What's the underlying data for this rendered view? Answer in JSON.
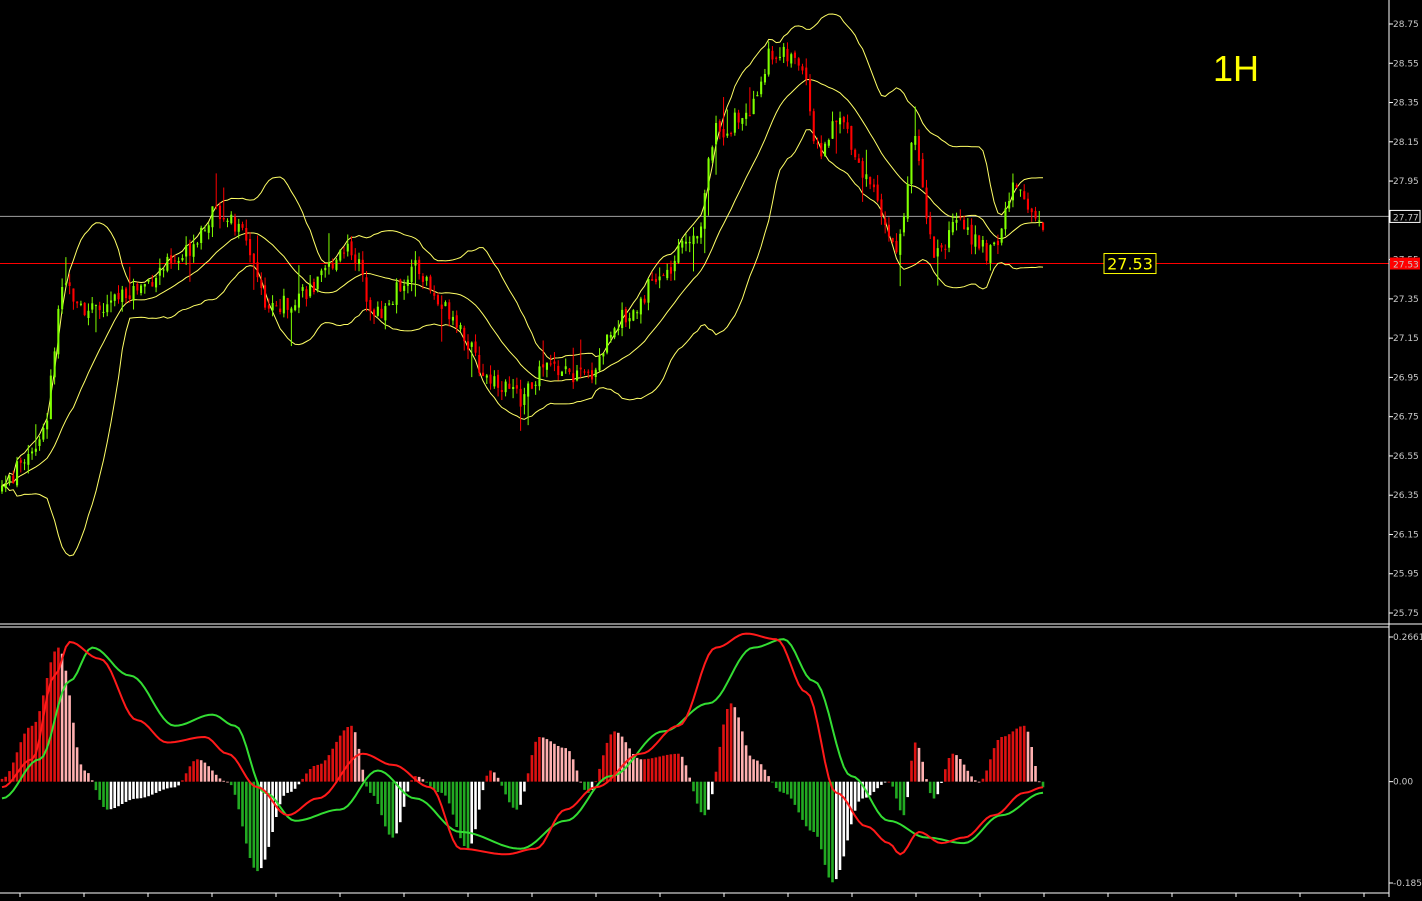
{
  "timeframe_label": "1H",
  "colors": {
    "background": "#000000",
    "bullish_candle": "#7fff00",
    "bearish_candle": "#ff0000",
    "bollinger": "#ffff66",
    "price_line": "#a0a0a0",
    "level_line": "#ff0000",
    "macd_line": "#ff1a1a",
    "signal_line": "#33dd33",
    "hist_pos_strong": "#dd1111",
    "hist_pos_weak": "#ffb0b0",
    "hist_neg_strong": "#22aa22",
    "hist_neg_weak": "#ffffff"
  },
  "chart_data": [
    {
      "type": "candlestick",
      "title": "",
      "indicators": [
        "Bollinger Bands"
      ],
      "y_ticks": [
        "28.75",
        "28.55",
        "28.35",
        "28.15",
        "27.95",
        "27.55",
        "27.35",
        "27.15",
        "26.95",
        "26.75",
        "26.55",
        "26.35",
        "26.15",
        "25.95",
        "25.75"
      ],
      "ylim": [
        25.7,
        28.85
      ],
      "current_price": 27.77,
      "current_price_label": "27.77",
      "level": 27.53,
      "level_label": "27.53",
      "level_axis_label": "27.53",
      "key_points": [
        {
          "i": 0,
          "v": 26.4
        },
        {
          "i": 10,
          "v": 26.62
        },
        {
          "i": 17,
          "v": 27.4
        },
        {
          "i": 25,
          "v": 27.28
        },
        {
          "i": 35,
          "v": 27.4
        },
        {
          "i": 45,
          "v": 27.52
        },
        {
          "i": 58,
          "v": 27.8
        },
        {
          "i": 63,
          "v": 27.7
        },
        {
          "i": 72,
          "v": 27.3
        },
        {
          "i": 82,
          "v": 27.4
        },
        {
          "i": 92,
          "v": 27.62
        },
        {
          "i": 100,
          "v": 27.28
        },
        {
          "i": 110,
          "v": 27.5
        },
        {
          "i": 118,
          "v": 27.3
        },
        {
          "i": 130,
          "v": 26.95
        },
        {
          "i": 138,
          "v": 26.85
        },
        {
          "i": 145,
          "v": 27.0
        },
        {
          "i": 155,
          "v": 26.95
        },
        {
          "i": 165,
          "v": 27.25
        },
        {
          "i": 175,
          "v": 27.45
        },
        {
          "i": 185,
          "v": 27.7
        },
        {
          "i": 190,
          "v": 28.2
        },
        {
          "i": 198,
          "v": 28.28
        },
        {
          "i": 205,
          "v": 28.6
        },
        {
          "i": 213,
          "v": 28.55
        },
        {
          "i": 217,
          "v": 28.1
        },
        {
          "i": 223,
          "v": 28.25
        },
        {
          "i": 231,
          "v": 27.95
        },
        {
          "i": 238,
          "v": 27.6
        },
        {
          "i": 243,
          "v": 28.15
        },
        {
          "i": 248,
          "v": 27.6
        },
        {
          "i": 255,
          "v": 27.72
        },
        {
          "i": 263,
          "v": 27.58
        },
        {
          "i": 270,
          "v": 27.92
        },
        {
          "i": 277,
          "v": 27.72
        }
      ],
      "bollinger": {
        "period": 20,
        "deviation": 2
      }
    },
    {
      "type": "bar",
      "title": "",
      "indicator": "MACD",
      "y_ticks": [
        "0.2661",
        "0.00",
        "-0.185"
      ],
      "ylim": [
        -0.185,
        0.2661
      ],
      "histogram_key_points": [
        {
          "i": 0,
          "v": 0.005
        },
        {
          "i": 8,
          "v": 0.1
        },
        {
          "i": 15,
          "v": 0.24
        },
        {
          "i": 22,
          "v": 0.02
        },
        {
          "i": 28,
          "v": -0.05
        },
        {
          "i": 36,
          "v": -0.03
        },
        {
          "i": 46,
          "v": -0.01
        },
        {
          "i": 52,
          "v": 0.04
        },
        {
          "i": 60,
          "v": 0.0
        },
        {
          "i": 68,
          "v": -0.16
        },
        {
          "i": 76,
          "v": -0.02
        },
        {
          "i": 84,
          "v": 0.03
        },
        {
          "i": 93,
          "v": 0.1
        },
        {
          "i": 98,
          "v": -0.02
        },
        {
          "i": 104,
          "v": -0.1
        },
        {
          "i": 110,
          "v": 0.01
        },
        {
          "i": 117,
          "v": -0.02
        },
        {
          "i": 124,
          "v": -0.12
        },
        {
          "i": 130,
          "v": 0.02
        },
        {
          "i": 137,
          "v": -0.05
        },
        {
          "i": 143,
          "v": 0.08
        },
        {
          "i": 150,
          "v": 0.06
        },
        {
          "i": 156,
          "v": -0.02
        },
        {
          "i": 163,
          "v": 0.09
        },
        {
          "i": 170,
          "v": 0.04
        },
        {
          "i": 180,
          "v": 0.05
        },
        {
          "i": 187,
          "v": -0.06
        },
        {
          "i": 194,
          "v": 0.14
        },
        {
          "i": 200,
          "v": 0.04
        },
        {
          "i": 208,
          "v": -0.02
        },
        {
          "i": 216,
          "v": -0.09
        },
        {
          "i": 221,
          "v": -0.18
        },
        {
          "i": 229,
          "v": -0.03
        },
        {
          "i": 236,
          "v": 0.0
        },
        {
          "i": 240,
          "v": -0.06
        },
        {
          "i": 243,
          "v": 0.07
        },
        {
          "i": 248,
          "v": -0.03
        },
        {
          "i": 253,
          "v": 0.05
        },
        {
          "i": 260,
          "v": 0.0
        },
        {
          "i": 266,
          "v": 0.08
        },
        {
          "i": 272,
          "v": 0.1
        },
        {
          "i": 277,
          "v": -0.01
        }
      ],
      "macd_key_points": [
        {
          "i": 0,
          "v": -0.01
        },
        {
          "i": 8,
          "v": 0.04
        },
        {
          "i": 14,
          "v": 0.19
        },
        {
          "i": 18,
          "v": 0.25
        },
        {
          "i": 26,
          "v": 0.22
        },
        {
          "i": 36,
          "v": 0.11
        },
        {
          "i": 44,
          "v": 0.07
        },
        {
          "i": 54,
          "v": 0.08
        },
        {
          "i": 60,
          "v": 0.05
        },
        {
          "i": 68,
          "v": -0.01
        },
        {
          "i": 76,
          "v": -0.06
        },
        {
          "i": 84,
          "v": -0.03
        },
        {
          "i": 96,
          "v": 0.05
        },
        {
          "i": 104,
          "v": 0.03
        },
        {
          "i": 114,
          "v": -0.01
        },
        {
          "i": 122,
          "v": -0.12
        },
        {
          "i": 134,
          "v": -0.13
        },
        {
          "i": 142,
          "v": -0.12
        },
        {
          "i": 150,
          "v": -0.05
        },
        {
          "i": 158,
          "v": -0.01
        },
        {
          "i": 170,
          "v": 0.05
        },
        {
          "i": 180,
          "v": 0.1
        },
        {
          "i": 190,
          "v": 0.24
        },
        {
          "i": 198,
          "v": 0.265
        },
        {
          "i": 206,
          "v": 0.255
        },
        {
          "i": 214,
          "v": 0.16
        },
        {
          "i": 222,
          "v": -0.02
        },
        {
          "i": 230,
          "v": -0.08
        },
        {
          "i": 236,
          "v": -0.11
        },
        {
          "i": 239,
          "v": -0.13
        },
        {
          "i": 244,
          "v": -0.09
        },
        {
          "i": 250,
          "v": -0.11
        },
        {
          "i": 256,
          "v": -0.1
        },
        {
          "i": 264,
          "v": -0.06
        },
        {
          "i": 272,
          "v": -0.02
        },
        {
          "i": 277,
          "v": -0.01
        }
      ],
      "signal_key_points": [
        {
          "i": 0,
          "v": -0.03
        },
        {
          "i": 10,
          "v": 0.04
        },
        {
          "i": 18,
          "v": 0.18
        },
        {
          "i": 24,
          "v": 0.24
        },
        {
          "i": 34,
          "v": 0.19
        },
        {
          "i": 46,
          "v": 0.1
        },
        {
          "i": 56,
          "v": 0.12
        },
        {
          "i": 62,
          "v": 0.1
        },
        {
          "i": 70,
          "v": -0.02
        },
        {
          "i": 78,
          "v": -0.07
        },
        {
          "i": 90,
          "v": -0.05
        },
        {
          "i": 100,
          "v": 0.02
        },
        {
          "i": 110,
          "v": -0.03
        },
        {
          "i": 122,
          "v": -0.09
        },
        {
          "i": 138,
          "v": -0.12
        },
        {
          "i": 150,
          "v": -0.07
        },
        {
          "i": 162,
          "v": 0.01
        },
        {
          "i": 176,
          "v": 0.09
        },
        {
          "i": 188,
          "v": 0.14
        },
        {
          "i": 200,
          "v": 0.24
        },
        {
          "i": 208,
          "v": 0.255
        },
        {
          "i": 216,
          "v": 0.18
        },
        {
          "i": 226,
          "v": 0.01
        },
        {
          "i": 236,
          "v": -0.07
        },
        {
          "i": 246,
          "v": -0.1
        },
        {
          "i": 256,
          "v": -0.11
        },
        {
          "i": 266,
          "v": -0.06
        },
        {
          "i": 277,
          "v": -0.02
        }
      ]
    }
  ]
}
